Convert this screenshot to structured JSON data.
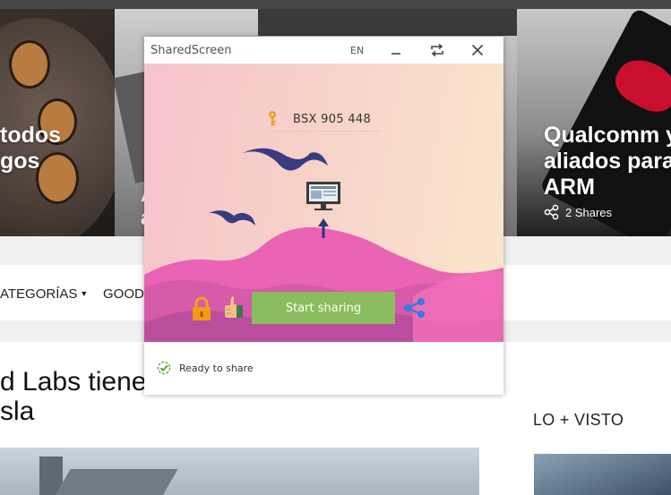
{
  "background_site": {
    "hero_left_lines": [
      "todos",
      "gos"
    ],
    "hero_middle_partial": [
      "A",
      "a"
    ],
    "hero_right_lines": [
      "Qualcomm y",
      "aliados para",
      "ARM"
    ],
    "hero_right_shares": "2 Shares",
    "nav_categories": "ATEGORÍAS",
    "nav_second": "GOOD",
    "article_title_lines": [
      "d Labs tiene",
      "sla"
    ],
    "sidebar_heading": "LO + VISTO"
  },
  "window": {
    "app_title": "SharedScreen",
    "language": "EN",
    "access_code": "BSX 905 448",
    "start_button_label": "Start sharing",
    "status_text": "Ready to share",
    "icons": {
      "key": "key-icon",
      "monitor": "monitor-icon",
      "lock": "lock-icon",
      "thumbs_up": "thumbs-up-icon",
      "share": "share-icon",
      "status": "check-circle-icon"
    },
    "colors": {
      "start_button": "#8bbc5d",
      "share_icon": "#2e7fe0",
      "hills": "#e964b4",
      "birds": "#3a3c80"
    }
  }
}
